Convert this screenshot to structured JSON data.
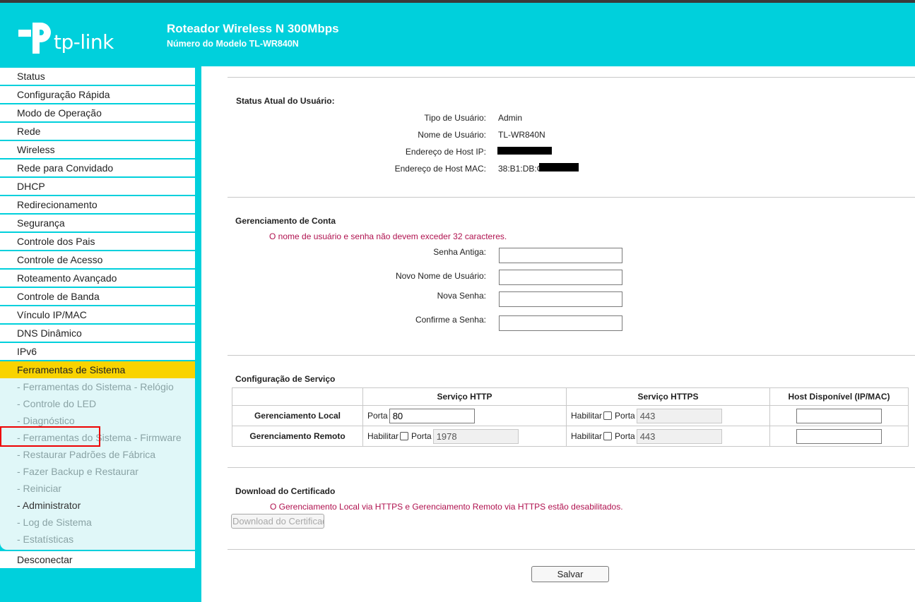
{
  "header": {
    "logo_text": "tp-link",
    "title": "Roteador Wireless N 300Mbps",
    "model": "Número do Modelo TL-WR840N",
    "brand_color": "#00d0dc"
  },
  "sidebar": {
    "items_before": [
      {
        "label": "Status"
      },
      {
        "label": "Configuração Rápida"
      },
      {
        "label": "Modo de Operação"
      },
      {
        "label": "Rede"
      },
      {
        "label": "Wireless"
      },
      {
        "label": "Rede para Convidado"
      },
      {
        "label": "DHCP"
      },
      {
        "label": "Redirecionamento"
      },
      {
        "label": "Segurança"
      },
      {
        "label": "Controle dos Pais"
      },
      {
        "label": "Controle de Acesso"
      },
      {
        "label": "Roteamento Avançado"
      },
      {
        "label": "Controle de Banda"
      },
      {
        "label": "Vínculo IP/MAC"
      },
      {
        "label": "DNS Dinâmico"
      },
      {
        "label": "IPv6"
      }
    ],
    "active": {
      "label": "Ferramentas de Sistema",
      "color": "#f9d300"
    },
    "sub_items": [
      {
        "label": "- Ferramentas do Sistema - Relógio"
      },
      {
        "label": "- Controle do LED"
      },
      {
        "label": "- Diagnóstico"
      },
      {
        "label": "- Ferramentas do Sistema - Firmware"
      },
      {
        "label": "- Restaurar Padrões de Fábrica"
      },
      {
        "label": "- Fazer Backup e Restaurar"
      },
      {
        "label": "- Reiniciar"
      },
      {
        "label": "- Administrator"
      },
      {
        "label": "- Log de Sistema"
      },
      {
        "label": "- Estatísticas"
      }
    ],
    "logout": {
      "label": "Desconectar"
    }
  },
  "user_status": {
    "title": "Status Atual do Usuário:",
    "user_type_label": "Tipo de Usuário:",
    "user_type": "Admin",
    "user_name_label": "Nome de Usuário:",
    "user_name": "TL-WR840N",
    "host_ip_label": "Endereço de Host IP:",
    "host_mac_label": "Endereço de Host MAC:",
    "host_mac": "38:B1:DB:C"
  },
  "account": {
    "title": "Gerenciamento de Conta",
    "note": "O nome de usuário e senha não devem exceder 32 caracteres.",
    "old_password_label": "Senha Antiga:",
    "new_username_label": "Novo Nome de Usuário:",
    "new_password_label": "Nova Senha:",
    "confirm_password_label": "Confirme a Senha:"
  },
  "service": {
    "title": "Configuração de Serviço",
    "columns": [
      "Serviço HTTP",
      "Serviço HTTPS",
      "Host Disponível (IP/MAC)"
    ],
    "enable_label": "Habilitar",
    "port_label": "Porta",
    "local": {
      "label": "Gerenciamento Local",
      "http_port": "80",
      "https_port": "443"
    },
    "remote": {
      "label": "Gerenciamento Remoto",
      "http_port": "1978",
      "https_port": "443"
    }
  },
  "certificate": {
    "title": "Download do Certificado",
    "note": "O Gerenciamento Local via HTTPS e Gerenciamento Remoto via HTTPS estão desabilitados.",
    "button_label": "Download do Certificado"
  },
  "save_label": "Salvar"
}
